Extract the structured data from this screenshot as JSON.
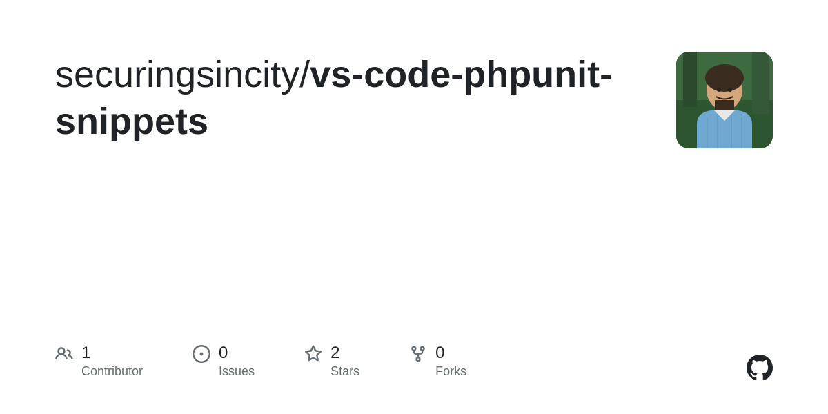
{
  "repo": {
    "owner": "securingsincity",
    "name": "vs-code-phpunit-snippets",
    "slash": "/"
  },
  "stats": {
    "contributors": {
      "count": "1",
      "label": "Contributor"
    },
    "issues": {
      "count": "0",
      "label": "Issues"
    },
    "stars": {
      "count": "2",
      "label": "Stars"
    },
    "forks": {
      "count": "0",
      "label": "Forks"
    }
  }
}
